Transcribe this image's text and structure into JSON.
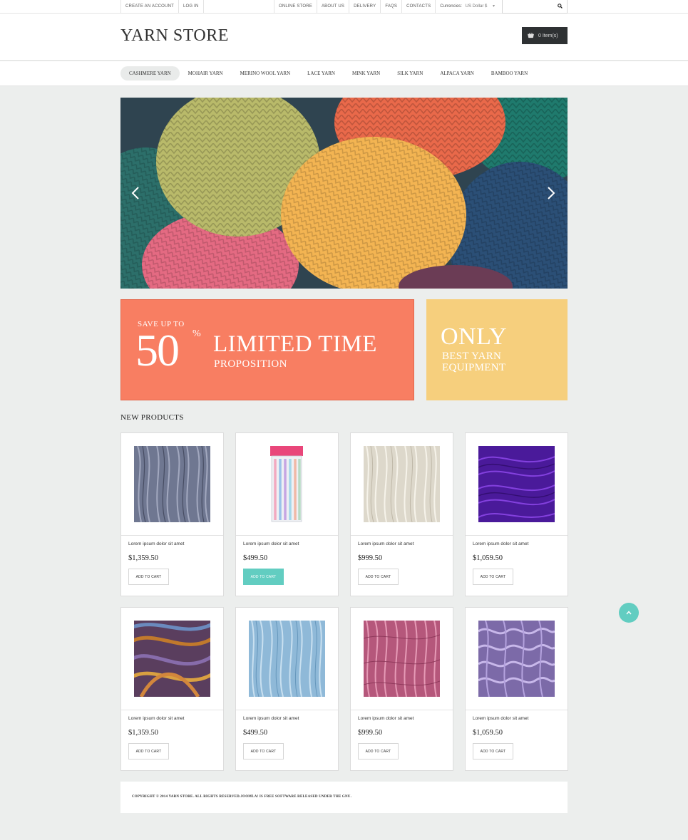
{
  "topbar": {
    "left_links": [
      "CREATE AN ACCOUNT",
      "LOG IN"
    ],
    "right_links": [
      "ONLINE STORE",
      "ABOUT US",
      "DELIVERY",
      "FAQS",
      "CONTACTS"
    ],
    "currency_label": "Currencies:",
    "currency_value": "US Dollar $"
  },
  "header": {
    "logo": "YARN STORE",
    "cart": "0 Item(s)"
  },
  "categories": [
    {
      "label": "CASHMERE YARN",
      "active": true
    },
    {
      "label": "MOHAIR YARN"
    },
    {
      "label": "MERINO WOOL YARN"
    },
    {
      "label": "LACE YARN"
    },
    {
      "label": "MINK YARN"
    },
    {
      "label": "SILK YARN"
    },
    {
      "label": "ALPACA YARN"
    },
    {
      "label": "BAMBOO YARN"
    }
  ],
  "banner_sale": {
    "save_up": "SAVE UP TO",
    "number": "50",
    "percent": "%",
    "title": "LIMITED TIME",
    "subtitle": "PROPOSITION"
  },
  "banner_only": {
    "title": "ONLY",
    "line1": "BEST YARN",
    "line2": "EQUIPMENT"
  },
  "section_title": "NEW PRODUCTS",
  "products": [
    {
      "name": "Lorem ipsum dolor sit amet",
      "price": "$1,359.50",
      "button": "ADD TO CART",
      "image": "gray-blue yarn"
    },
    {
      "name": "Lorem ipsum dolor sit amet",
      "price": "$499.50",
      "button": "ADD TO CART",
      "image": "knitting needles pack",
      "highlight": true
    },
    {
      "name": "Lorem ipsum dolor sit amet",
      "price": "$999.50",
      "button": "ADD TO CART",
      "image": "cream yarn"
    },
    {
      "name": "Lorem ipsum dolor sit amet",
      "price": "$1,059.50",
      "button": "ADD TO CART",
      "image": "purple yarn"
    },
    {
      "name": "Lorem ipsum dolor sit amet",
      "price": "$1,359.50",
      "button": "ADD TO CART",
      "image": "multicolor yarn"
    },
    {
      "name": "Lorem ipsum dolor sit amet",
      "price": "$499.50",
      "button": "ADD TO CART",
      "image": "light blue yarn"
    },
    {
      "name": "Lorem ipsum dolor sit amet",
      "price": "$999.50",
      "button": "ADD TO CART",
      "image": "pink yarn"
    },
    {
      "name": "Lorem ipsum dolor sit amet",
      "price": "$1,059.50",
      "button": "ADD TO CART",
      "image": "lavender yarn"
    }
  ],
  "footer": {
    "copyright": "COPYRIGHT © 2014 YARN STORE. ALL RIGHTS RESERVED.JOOMLA! IS FREE SOFTWARE RELEASED UNDER THE GNU."
  },
  "colors": {
    "accent_teal": "#62cdc1",
    "sale_banner": "#f87e62",
    "only_banner": "#f6cf7d",
    "cart_bg": "#2e3133"
  },
  "icons": [
    "search-icon",
    "cart-icon",
    "chevron-left-icon",
    "chevron-right-icon",
    "chevron-up-icon"
  ]
}
